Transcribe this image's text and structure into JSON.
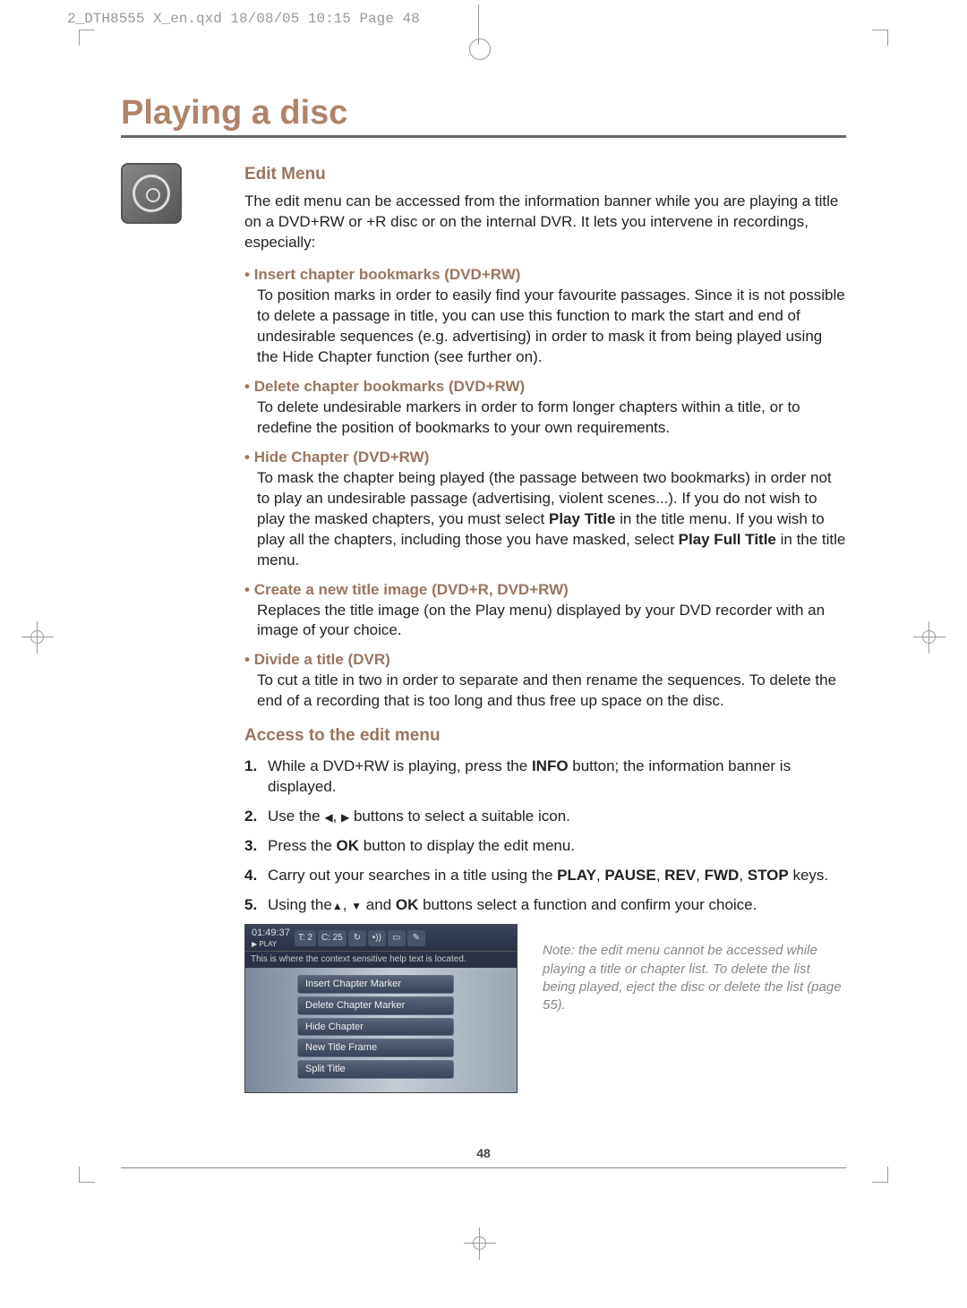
{
  "print_header": "2_DTH8555 X_en.qxd  18/08/05  10:15  Page 48",
  "title": "Playing a disc",
  "section1": {
    "heading": "Edit Menu",
    "intro": "The edit menu can be accessed from the information banner while you are playing a title on a DVD+RW or +R disc or on the internal DVR. It lets you intervene in recordings, especially:",
    "bullets": [
      {
        "h": "Insert chapter bookmarks (DVD+RW)",
        "body": "To position marks in order to easily find your favourite passages. Since it is not possible to delete a passage in title, you can use this function to mark the start and end of undesirable sequences (e.g. advertising) in order to mask it from being played using the Hide Chapter function (see further on)."
      },
      {
        "h": "Delete chapter bookmarks (DVD+RW)",
        "body": "To delete undesirable markers in order to form longer chapters within a title, or to redefine the position of bookmarks to your own requirements."
      },
      {
        "h": "Hide Chapter (DVD+RW)",
        "body_html": "To mask the chapter being played (the passage between two bookmarks) in order not to play an undesirable passage (advertising, violent scenes...). If you do not wish to play the masked chapters, you must select <b>Play Title</b> in the title menu. If you wish to play all the chapters, including those you have masked, select <b>Play Full Title</b> in the title menu."
      },
      {
        "h": "Create a new title image (DVD+R, DVD+RW)",
        "body": "Replaces the title image (on the Play menu) displayed by your DVD recorder with an image of your choice."
      },
      {
        "h": "Divide a title (DVR)",
        "body": "To cut a title in two in order to separate and then rename the sequences. To delete the end of a recording that is too long and thus free up space on the disc."
      }
    ]
  },
  "section2": {
    "heading": "Access to the edit menu",
    "steps": [
      {
        "n": "1.",
        "html": "While a DVD+RW is playing, press the <b>INFO</b> button; the information banner is displayed."
      },
      {
        "n": "2.",
        "html": "Use the <span class='tri-l'></span>, <span class='tri-r'></span> buttons to select a suitable icon."
      },
      {
        "n": "3.",
        "html": "Press the <b>OK</b> button to display the edit menu."
      },
      {
        "n": "4.",
        "html": "Carry out your searches in a title using the <b>PLAY</b>, <b>PAUSE</b>, <b>REV</b>, <b>FWD</b>, <b>STOP</b> keys."
      },
      {
        "n": "5.",
        "html": "Using the<span class='tri-u'></span>, <span class='tri-d'></span> and <b>OK</b> buttons select a function and confirm your choice."
      }
    ]
  },
  "screenshot": {
    "time": "01:49:37",
    "play": "▶ PLAY",
    "t": "T: 2",
    "c": "C: 25",
    "help": "This is where the context sensitive help text is located.",
    "items": [
      "Insert Chapter Marker",
      "Delete Chapter Marker",
      "Hide Chapter",
      "New Title Frame",
      "Split Title"
    ]
  },
  "note": "Note: the edit menu cannot be accessed while playing a title or chapter list. To delete the list being played, eject the disc or delete the list (page 55).",
  "page_num": "48"
}
